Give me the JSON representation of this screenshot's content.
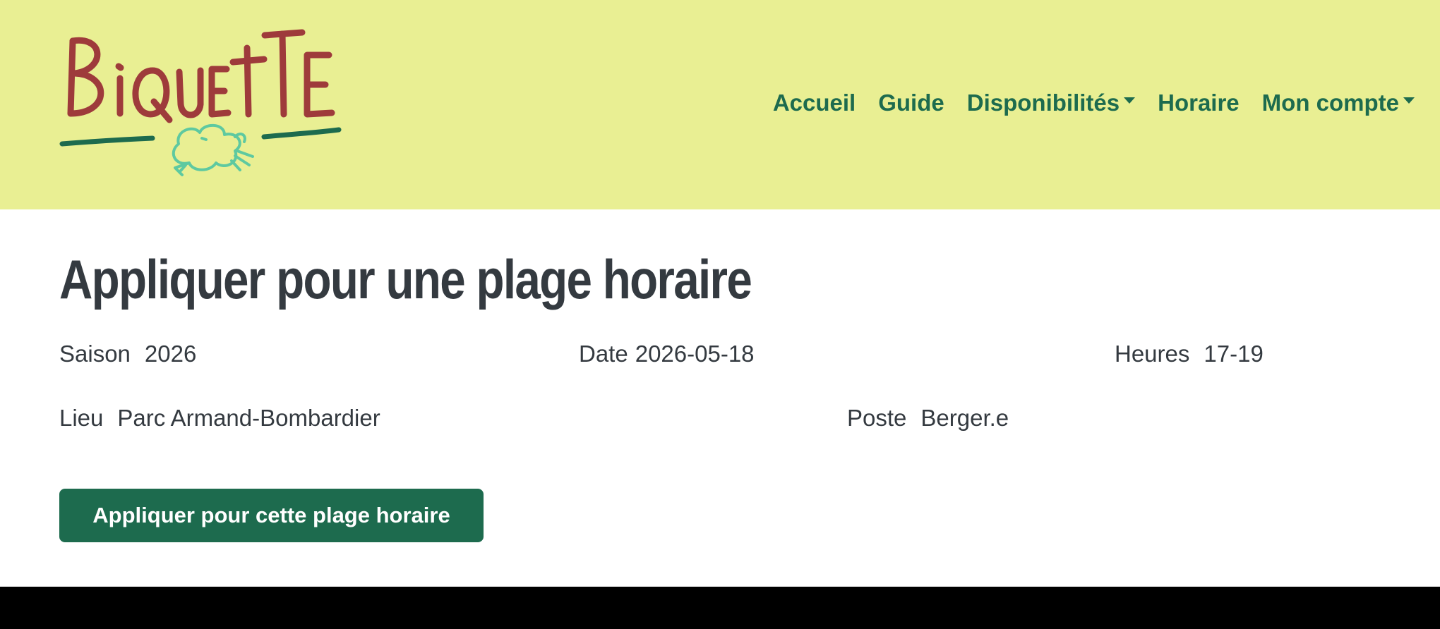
{
  "brand": {
    "logo_text": "BiQUETTE",
    "logo_colors": {
      "letters": "#9e3b3b",
      "underline": "#1d6b4e",
      "sheep": "#5ec9a0"
    }
  },
  "nav": {
    "items": [
      {
        "label": "Accueil",
        "dropdown": false
      },
      {
        "label": "Guide",
        "dropdown": false
      },
      {
        "label": "Disponibilités",
        "dropdown": true
      },
      {
        "label": "Horaire",
        "dropdown": false
      },
      {
        "label": "Mon compte",
        "dropdown": true
      }
    ]
  },
  "page": {
    "title": "Appliquer pour une plage horaire"
  },
  "details": {
    "saison": {
      "label": "Saison",
      "value": "2026"
    },
    "date": {
      "label": "Date",
      "value": "2026-05-18"
    },
    "heures": {
      "label": "Heures",
      "value": "17-19"
    },
    "lieu": {
      "label": "Lieu",
      "value": "Parc Armand-Bombardier"
    },
    "poste": {
      "label": "Poste",
      "value": "Berger.e"
    }
  },
  "actions": {
    "apply_label": "Appliquer pour cette plage horaire"
  },
  "colors": {
    "header_bg": "#e9ef93",
    "primary": "#1d6b4e",
    "text": "#343a40",
    "footer_bg": "#000000"
  }
}
